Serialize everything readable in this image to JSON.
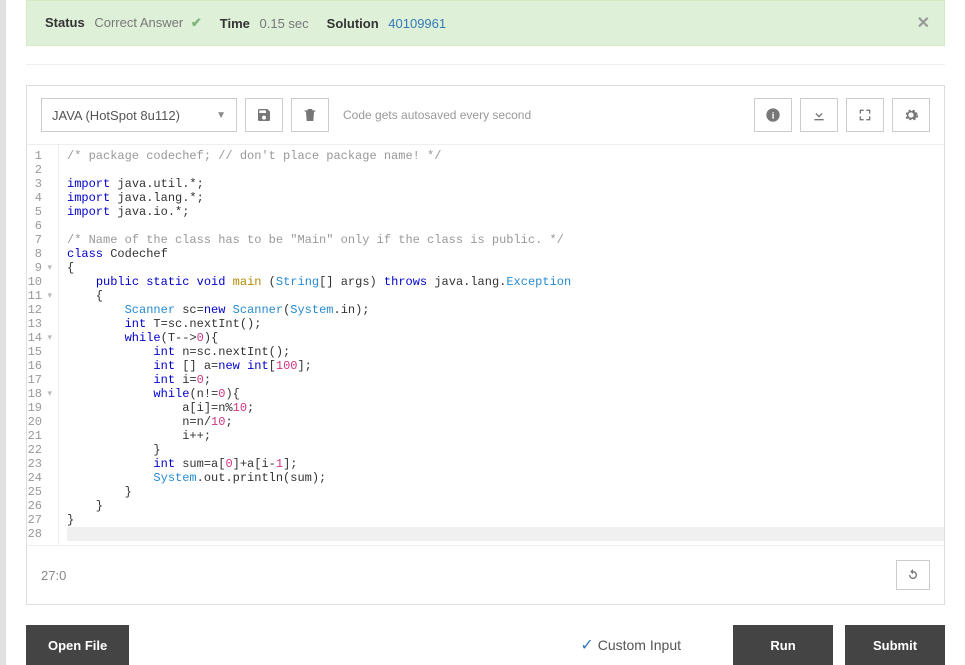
{
  "status": {
    "status_label": "Status",
    "status_value": "Correct Answer",
    "time_label": "Time",
    "time_value": "0.15 sec",
    "solution_label": "Solution",
    "solution_value": "40109961"
  },
  "toolbar": {
    "language": "JAVA (HotSpot 8u112)",
    "autosave_text": "Code gets autosaved every second"
  },
  "cursor_position": "27:0",
  "code": {
    "lines": [
      {
        "n": 1,
        "fold": false,
        "tokens": [
          {
            "t": "/* package codechef; // don't place package name! */",
            "c": "tok-comment"
          }
        ]
      },
      {
        "n": 2,
        "fold": false,
        "tokens": []
      },
      {
        "n": 3,
        "fold": false,
        "tokens": [
          {
            "t": "import",
            "c": "tok-keyword"
          },
          {
            "t": " java.util.*;",
            "c": "tok-ident"
          }
        ]
      },
      {
        "n": 4,
        "fold": false,
        "tokens": [
          {
            "t": "import",
            "c": "tok-keyword"
          },
          {
            "t": " java.lang.*;",
            "c": "tok-ident"
          }
        ]
      },
      {
        "n": 5,
        "fold": false,
        "tokens": [
          {
            "t": "import",
            "c": "tok-keyword"
          },
          {
            "t": " java.io.*;",
            "c": "tok-ident"
          }
        ]
      },
      {
        "n": 6,
        "fold": false,
        "tokens": []
      },
      {
        "n": 7,
        "fold": false,
        "tokens": [
          {
            "t": "/* Name of the class has to be \"Main\" only if the class is public. */",
            "c": "tok-comment"
          }
        ]
      },
      {
        "n": 8,
        "fold": false,
        "tokens": [
          {
            "t": "class",
            "c": "tok-keyword"
          },
          {
            "t": " ",
            "c": ""
          },
          {
            "t": "Codechef",
            "c": "tok-ident"
          }
        ]
      },
      {
        "n": 9,
        "fold": true,
        "tokens": [
          {
            "t": "{",
            "c": "tok-ident"
          }
        ]
      },
      {
        "n": 10,
        "fold": false,
        "tokens": [
          {
            "t": "    ",
            "c": ""
          },
          {
            "t": "public",
            "c": "tok-keyword"
          },
          {
            "t": " ",
            "c": ""
          },
          {
            "t": "static",
            "c": "tok-keyword"
          },
          {
            "t": " ",
            "c": ""
          },
          {
            "t": "void",
            "c": "tok-keyword"
          },
          {
            "t": " ",
            "c": ""
          },
          {
            "t": "main",
            "c": "tok-class"
          },
          {
            "t": " (",
            "c": ""
          },
          {
            "t": "String",
            "c": "tok-type"
          },
          {
            "t": "[] args) ",
            "c": "tok-ident"
          },
          {
            "t": "throws",
            "c": "tok-keyword"
          },
          {
            "t": " java.lang.",
            "c": "tok-ident"
          },
          {
            "t": "Exception",
            "c": "tok-type"
          }
        ]
      },
      {
        "n": 11,
        "fold": true,
        "tokens": [
          {
            "t": "    {",
            "c": "tok-ident"
          }
        ]
      },
      {
        "n": 12,
        "fold": false,
        "tokens": [
          {
            "t": "        ",
            "c": ""
          },
          {
            "t": "Scanner",
            "c": "tok-type"
          },
          {
            "t": " sc=",
            "c": "tok-ident"
          },
          {
            "t": "new",
            "c": "tok-keyword"
          },
          {
            "t": " ",
            "c": ""
          },
          {
            "t": "Scanner",
            "c": "tok-type"
          },
          {
            "t": "(",
            "c": ""
          },
          {
            "t": "System",
            "c": "tok-type"
          },
          {
            "t": ".in);",
            "c": "tok-ident"
          }
        ]
      },
      {
        "n": 13,
        "fold": false,
        "tokens": [
          {
            "t": "        ",
            "c": ""
          },
          {
            "t": "int",
            "c": "tok-keyword"
          },
          {
            "t": " T=sc.nextInt();",
            "c": "tok-ident"
          }
        ]
      },
      {
        "n": 14,
        "fold": true,
        "tokens": [
          {
            "t": "        ",
            "c": ""
          },
          {
            "t": "while",
            "c": "tok-keyword"
          },
          {
            "t": "(T-->",
            "c": "tok-ident"
          },
          {
            "t": "0",
            "c": "tok-num"
          },
          {
            "t": "){",
            "c": "tok-ident"
          }
        ]
      },
      {
        "n": 15,
        "fold": false,
        "tokens": [
          {
            "t": "            ",
            "c": ""
          },
          {
            "t": "int",
            "c": "tok-keyword"
          },
          {
            "t": " n=sc.nextInt();",
            "c": "tok-ident"
          }
        ]
      },
      {
        "n": 16,
        "fold": false,
        "tokens": [
          {
            "t": "            ",
            "c": ""
          },
          {
            "t": "int",
            "c": "tok-keyword"
          },
          {
            "t": " [] a=",
            "c": "tok-ident"
          },
          {
            "t": "new",
            "c": "tok-keyword"
          },
          {
            "t": " ",
            "c": ""
          },
          {
            "t": "int",
            "c": "tok-keyword"
          },
          {
            "t": "[",
            "c": "tok-ident"
          },
          {
            "t": "100",
            "c": "tok-num"
          },
          {
            "t": "];",
            "c": "tok-ident"
          }
        ]
      },
      {
        "n": 17,
        "fold": false,
        "tokens": [
          {
            "t": "            ",
            "c": ""
          },
          {
            "t": "int",
            "c": "tok-keyword"
          },
          {
            "t": " i=",
            "c": "tok-ident"
          },
          {
            "t": "0",
            "c": "tok-num"
          },
          {
            "t": ";",
            "c": "tok-ident"
          }
        ]
      },
      {
        "n": 18,
        "fold": true,
        "tokens": [
          {
            "t": "            ",
            "c": ""
          },
          {
            "t": "while",
            "c": "tok-keyword"
          },
          {
            "t": "(n!=",
            "c": "tok-ident"
          },
          {
            "t": "0",
            "c": "tok-num"
          },
          {
            "t": "){",
            "c": "tok-ident"
          }
        ]
      },
      {
        "n": 19,
        "fold": false,
        "tokens": [
          {
            "t": "                a[i]=n%",
            "c": "tok-ident"
          },
          {
            "t": "10",
            "c": "tok-num"
          },
          {
            "t": ";",
            "c": "tok-ident"
          }
        ]
      },
      {
        "n": 20,
        "fold": false,
        "tokens": [
          {
            "t": "                n=n/",
            "c": "tok-ident"
          },
          {
            "t": "10",
            "c": "tok-num"
          },
          {
            "t": ";",
            "c": "tok-ident"
          }
        ]
      },
      {
        "n": 21,
        "fold": false,
        "tokens": [
          {
            "t": "                i++;",
            "c": "tok-ident"
          }
        ]
      },
      {
        "n": 22,
        "fold": false,
        "tokens": [
          {
            "t": "            }",
            "c": "tok-ident"
          }
        ]
      },
      {
        "n": 23,
        "fold": false,
        "tokens": [
          {
            "t": "            ",
            "c": ""
          },
          {
            "t": "int",
            "c": "tok-keyword"
          },
          {
            "t": " sum=a[",
            "c": "tok-ident"
          },
          {
            "t": "0",
            "c": "tok-num"
          },
          {
            "t": "]+a[i-",
            "c": "tok-ident"
          },
          {
            "t": "1",
            "c": "tok-num"
          },
          {
            "t": "];",
            "c": "tok-ident"
          }
        ]
      },
      {
        "n": 24,
        "fold": false,
        "tokens": [
          {
            "t": "            ",
            "c": ""
          },
          {
            "t": "System",
            "c": "tok-type"
          },
          {
            "t": ".out.println(sum);",
            "c": "tok-ident"
          }
        ]
      },
      {
        "n": 25,
        "fold": false,
        "tokens": [
          {
            "t": "        }",
            "c": "tok-ident"
          }
        ]
      },
      {
        "n": 26,
        "fold": false,
        "tokens": [
          {
            "t": "    }",
            "c": "tok-ident"
          }
        ]
      },
      {
        "n": 27,
        "fold": false,
        "tokens": [
          {
            "t": "}",
            "c": "tok-ident"
          }
        ]
      },
      {
        "n": 28,
        "fold": false,
        "hl": true,
        "tokens": []
      }
    ]
  },
  "actions": {
    "open_file": "Open File",
    "custom_input": "Custom Input",
    "run": "Run",
    "submit": "Submit"
  }
}
